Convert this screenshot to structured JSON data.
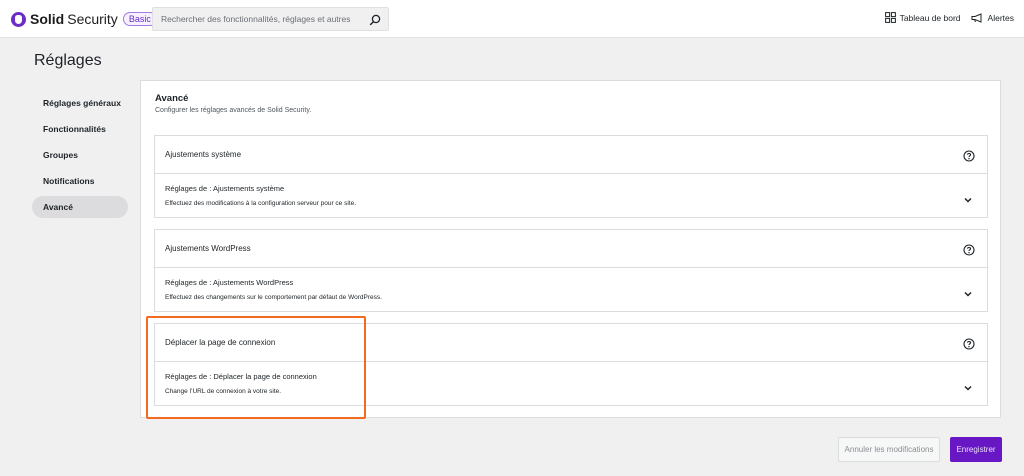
{
  "brand": {
    "name_bold": "Solid",
    "name_regular": "Security",
    "badge": "Basic",
    "accent": "#6b2ec5"
  },
  "search": {
    "placeholder": "Rechercher des fonctionnalités, réglages et autres",
    "icon": "search-icon"
  },
  "top_actions": [
    {
      "label": "Tableau de bord",
      "icon": "dashboard-icon"
    },
    {
      "label": "Alertes",
      "icon": "megaphone-icon"
    }
  ],
  "page_title": "Réglages",
  "sidebar": {
    "items": [
      {
        "label": "Réglages généraux",
        "active": false
      },
      {
        "label": "Fonctionnalités",
        "active": false
      },
      {
        "label": "Groupes",
        "active": false
      },
      {
        "label": "Notifications",
        "active": false
      },
      {
        "label": "Avancé",
        "active": true
      }
    ]
  },
  "panel": {
    "title": "Avancé",
    "description": "Configurer les réglages avancés de Solid Security."
  },
  "cards": [
    {
      "title": "Ajustements système",
      "row_title": "Réglages de : Ajustements système",
      "row_desc": "Effectuez des modifications à la configuration serveur pour ce site."
    },
    {
      "title": "Ajustements WordPress",
      "row_title": "Réglages de : Ajustements WordPress",
      "row_desc": "Effectuez des changements sur le comportement par défaut de WordPress."
    },
    {
      "title": "Déplacer la page de connexion",
      "row_title": "Réglages de : Déplacer la page de connexion",
      "row_desc": "Change l’URL de connexion à votre site."
    }
  ],
  "footer": {
    "cancel_label": "Annuler les modifications",
    "save_label": "Enregistrer",
    "save_color": "#6817c5"
  },
  "highlight_color": "#f26b21"
}
